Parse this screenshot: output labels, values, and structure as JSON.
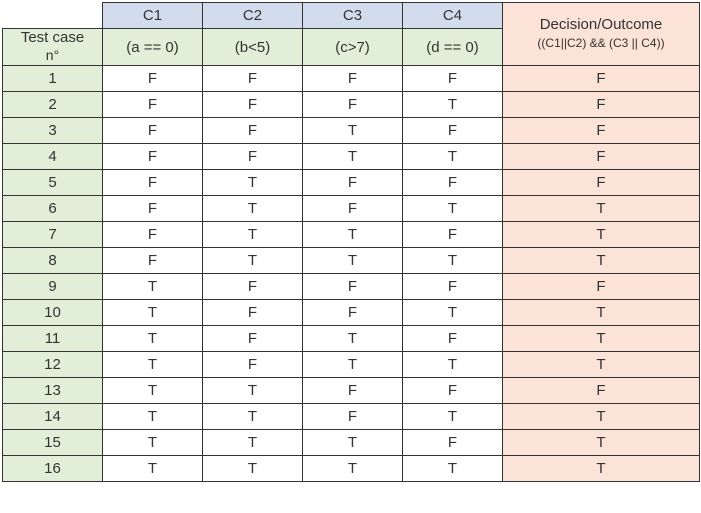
{
  "header": {
    "testCase": {
      "line1": "Test case",
      "line2": "n°"
    },
    "conditions": [
      {
        "name": "C1",
        "expr": "(a == 0)"
      },
      {
        "name": "C2",
        "expr": "(b<5)"
      },
      {
        "name": "C3",
        "expr": "(c>7)"
      },
      {
        "name": "C4",
        "expr": "(d == 0)"
      }
    ],
    "outcome": {
      "line1": "Decision/Outcome",
      "line2": "((C1||C2) && (C3 || C4))"
    }
  },
  "rows": [
    {
      "n": "1",
      "c": [
        "F",
        "F",
        "F",
        "F"
      ],
      "out": "F"
    },
    {
      "n": "2",
      "c": [
        "F",
        "F",
        "F",
        "T"
      ],
      "out": "F"
    },
    {
      "n": "3",
      "c": [
        "F",
        "F",
        "T",
        "F"
      ],
      "out": "F"
    },
    {
      "n": "4",
      "c": [
        "F",
        "F",
        "T",
        "T"
      ],
      "out": "F"
    },
    {
      "n": "5",
      "c": [
        "F",
        "T",
        "F",
        "F"
      ],
      "out": "F"
    },
    {
      "n": "6",
      "c": [
        "F",
        "T",
        "F",
        "T"
      ],
      "out": "T"
    },
    {
      "n": "7",
      "c": [
        "F",
        "T",
        "T",
        "F"
      ],
      "out": "T"
    },
    {
      "n": "8",
      "c": [
        "F",
        "T",
        "T",
        "T"
      ],
      "out": "T"
    },
    {
      "n": "9",
      "c": [
        "T",
        "F",
        "F",
        "F"
      ],
      "out": "F"
    },
    {
      "n": "10",
      "c": [
        "T",
        "F",
        "F",
        "T"
      ],
      "out": "T"
    },
    {
      "n": "11",
      "c": [
        "T",
        "F",
        "T",
        "F"
      ],
      "out": "T"
    },
    {
      "n": "12",
      "c": [
        "T",
        "F",
        "T",
        "T"
      ],
      "out": "T"
    },
    {
      "n": "13",
      "c": [
        "T",
        "T",
        "F",
        "F"
      ],
      "out": "F"
    },
    {
      "n": "14",
      "c": [
        "T",
        "T",
        "F",
        "T"
      ],
      "out": "T"
    },
    {
      "n": "15",
      "c": [
        "T",
        "T",
        "T",
        "F"
      ],
      "out": "T"
    },
    {
      "n": "16",
      "c": [
        "T",
        "T",
        "T",
        "T"
      ],
      "out": "T"
    }
  ]
}
